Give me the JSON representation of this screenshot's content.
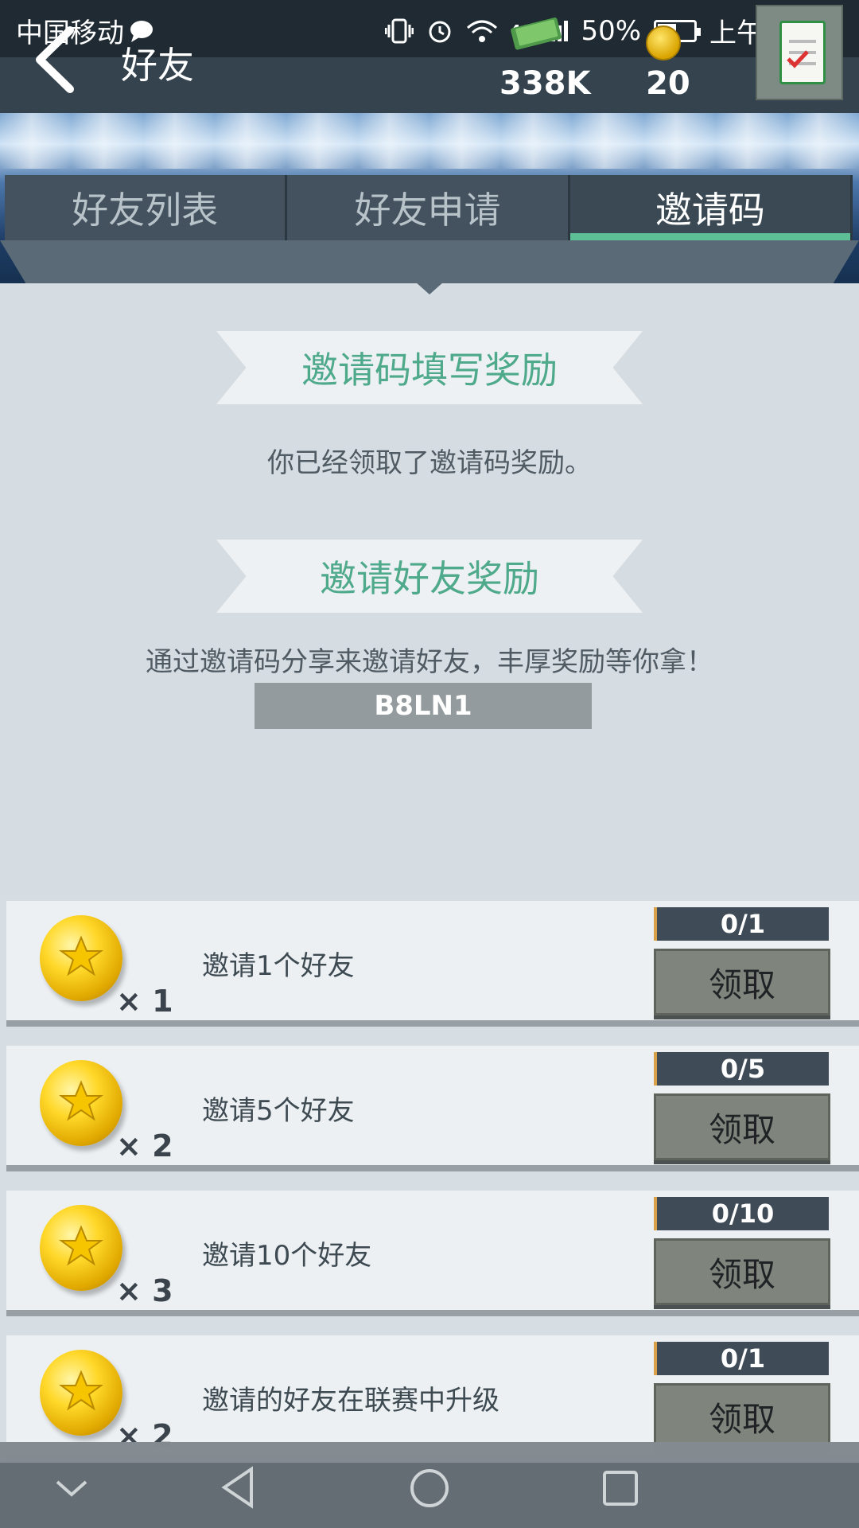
{
  "status_bar": {
    "carrier": "中国移动",
    "network": "4G",
    "battery": "50%",
    "battery_level": 0.5,
    "time": "上午10:53"
  },
  "header": {
    "title": "好友",
    "money": "338K",
    "coins": "20"
  },
  "tabs": [
    {
      "label": "好友列表",
      "active": false
    },
    {
      "label": "好友申请",
      "active": false
    },
    {
      "label": "邀请码",
      "active": true
    }
  ],
  "invite_code_section": {
    "title": "邀请码填写奖励",
    "message": "你已经领取了邀请码奖励。"
  },
  "invite_friends_section": {
    "title": "邀请好友奖励",
    "message": "通过邀请码分享来邀请好友，丰厚奖励等你拿！",
    "code": "B8LN1"
  },
  "rewards": [
    {
      "multiplier": "× 1",
      "label": "邀请1个好友",
      "progress": "0/1",
      "button": "领取"
    },
    {
      "multiplier": "× 2",
      "label": "邀请5个好友",
      "progress": "0/5",
      "button": "领取"
    },
    {
      "multiplier": "× 3",
      "label": "邀请10个好友",
      "progress": "0/10",
      "button": "领取"
    },
    {
      "multiplier": "× 2",
      "label": "邀请的好友在联赛中升级",
      "progress": "0/1",
      "button": "领取"
    }
  ],
  "colors": {
    "accent": "#5dbf96",
    "header": "#34434e",
    "ribbon_text": "#4fa98b"
  }
}
